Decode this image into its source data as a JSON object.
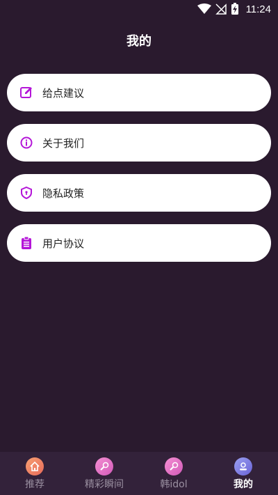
{
  "status_bar": {
    "time": "11:24"
  },
  "header": {
    "title": "我的"
  },
  "menu": {
    "items": [
      {
        "label": "给点建议",
        "icon": "edit-icon"
      },
      {
        "label": "关于我们",
        "icon": "info-icon"
      },
      {
        "label": "隐私政策",
        "icon": "shield-icon"
      },
      {
        "label": "用户协议",
        "icon": "clipboard-icon"
      }
    ]
  },
  "bottom_nav": {
    "items": [
      {
        "label": "推荐",
        "icon": "home-icon"
      },
      {
        "label": "精彩瞬间",
        "icon": "microphone-icon"
      },
      {
        "label": "韩idol",
        "icon": "microphone-icon"
      },
      {
        "label": "我的",
        "icon": "profile-icon",
        "active": true
      }
    ]
  },
  "colors": {
    "background": "#2a1a2e",
    "accent_purple": "#b416d8",
    "card": "#ffffff"
  }
}
